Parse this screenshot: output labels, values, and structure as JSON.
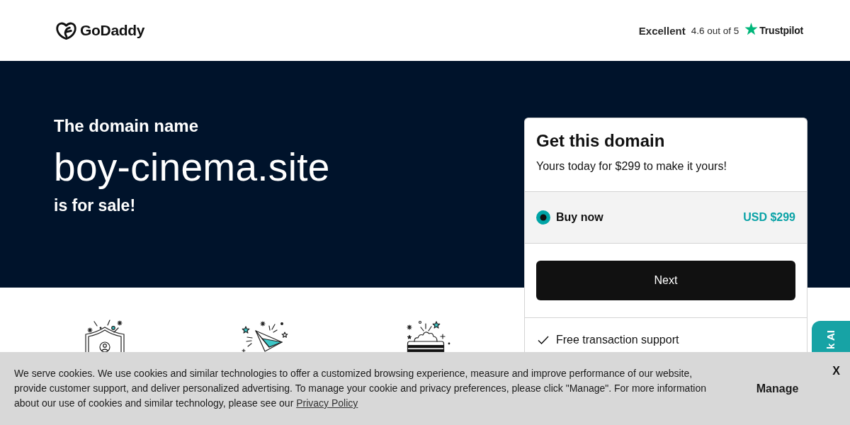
{
  "header": {
    "logo": {
      "wordmark": "GoDaddy"
    },
    "rating": {
      "label": "Excellent",
      "score": "4.6 out of 5",
      "brand": "Trustpilot"
    }
  },
  "hero": {
    "intro": "The domain name",
    "domain": "boy-cinema.site",
    "tagline": "is for sale!"
  },
  "offer_card": {
    "title": "Get this domain",
    "subtitle": "Yours today for $299 to make it yours!",
    "options": [
      {
        "label": "Buy now",
        "price": "USD $299",
        "selected": true
      }
    ],
    "button": "Next",
    "features": [
      "Free transaction support"
    ]
  },
  "side_tab": {
    "label": "k AI"
  },
  "cookie_banner": {
    "message": "We serve cookies. We use cookies and similar technologies to offer a customized browsing experience, measure and improve performance of our website, provide customer support, and deliver personalized advertising. To manage your cookie and privacy preferences, please click \"Manage\". For more information about our use of cookies and similar technology, please see our",
    "link": "Privacy Policy",
    "manage": "Manage",
    "close": "X"
  }
}
